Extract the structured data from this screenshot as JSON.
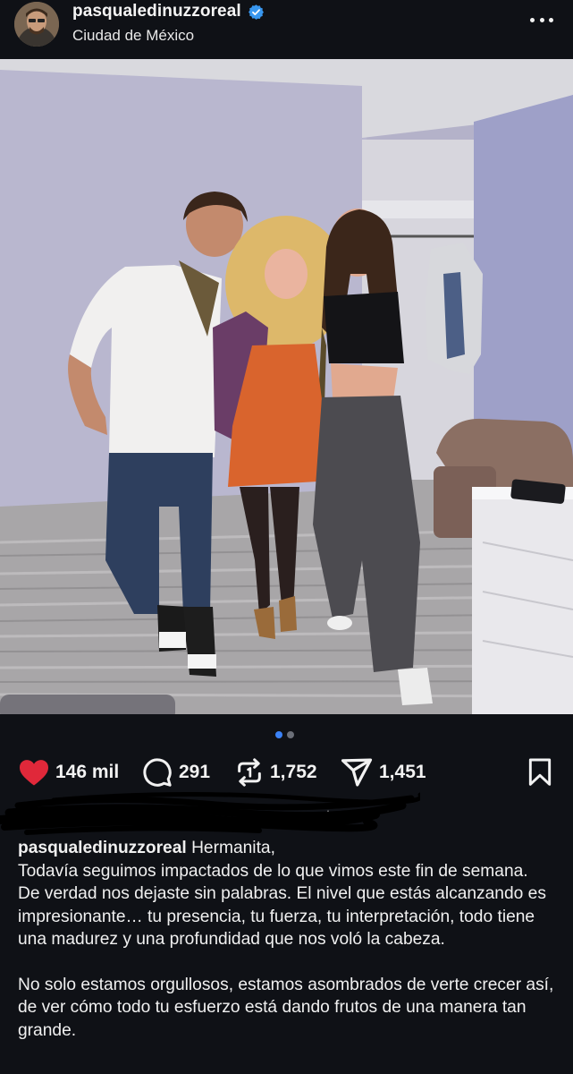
{
  "post": {
    "username": "pasqualedinuzzoreal",
    "location": "Ciudad de México"
  },
  "stats": {
    "likes": "146 mil",
    "comments": "291",
    "reposts": "1,752",
    "shares": "1,451"
  },
  "likers": {
    "text": "... y otros"
  },
  "caption": {
    "username": "pasqualedinuzzoreal",
    "first_line": "Hermanita,",
    "para1": "Todavía seguimos impactados de lo que vimos este fin de semana. De verdad nos dejaste sin palabras. El nivel que estás alcanzando es impresionante… tu presencia, tu fuerza, tu interpretación, todo tiene una madurez y una profundidad que nos voló la cabeza.",
    "para2": "No solo estamos orgullosos, estamos asombrados de verte crecer así, de ver cómo todo tu esfuerzo está dando frutos de una manera tan grande."
  },
  "carousel": {
    "total": 2,
    "active": 1
  },
  "colors": {
    "background": "#0f1116",
    "like_red": "#e0283a",
    "verified_blue": "#3897f0",
    "pager_active": "#3b82f6",
    "pager_inactive": "#6b6f78"
  },
  "icons": [
    "verified-badge-icon",
    "more-options-icon",
    "heart-icon",
    "comment-icon",
    "repost-icon",
    "share-icon",
    "bookmark-icon"
  ]
}
